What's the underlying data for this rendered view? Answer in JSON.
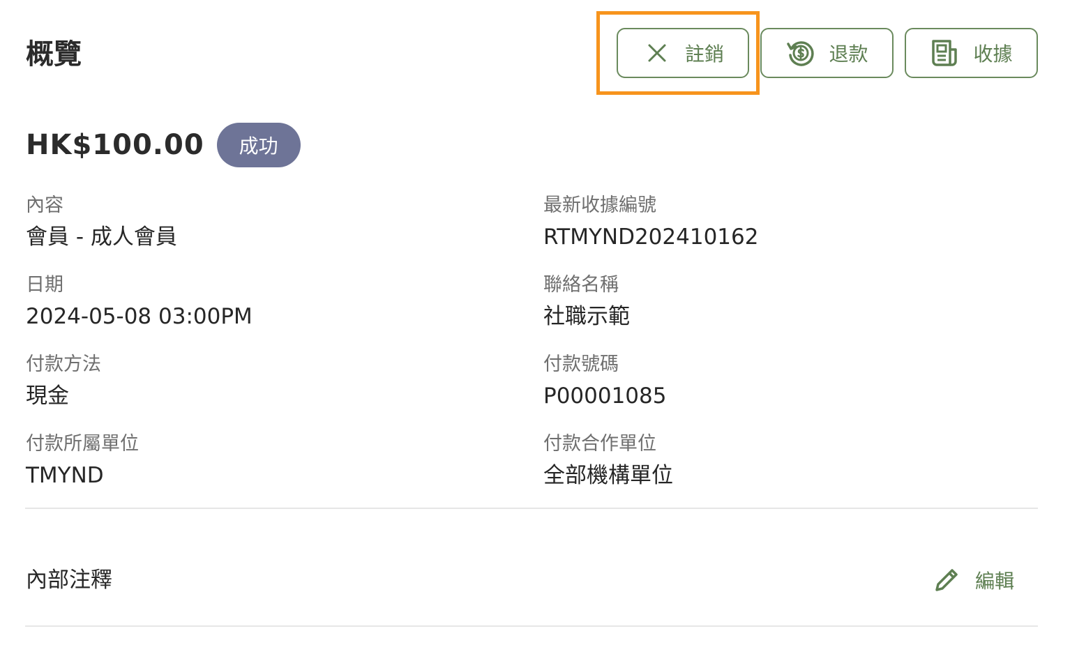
{
  "page": {
    "title": "概覽"
  },
  "actions": {
    "cancel_label": "註銷",
    "refund_label": "退款",
    "receipt_label": "收據",
    "accent_color": "#5e7f52",
    "highlight_color": "#f7941d"
  },
  "summary": {
    "amount": "HK$100.00",
    "status": "成功",
    "status_color": "#6e7497"
  },
  "details": {
    "content_label": "內容",
    "content_value": "會員 - 成人會員",
    "receipt_no_label": "最新收據編號",
    "receipt_no_value": "RTMYND202410162",
    "date_label": "日期",
    "date_value": "2024-05-08 03:00PM",
    "contact_label": "聯絡名稱",
    "contact_value": "社職示範",
    "method_label": "付款方法",
    "method_value": "現金",
    "payment_no_label": "付款號碼",
    "payment_no_value": "P00001085",
    "unit_label": "付款所屬單位",
    "unit_value": "TMYND",
    "partner_label": "付款合作單位",
    "partner_value": "全部機構單位"
  },
  "notes": {
    "title": "內部注釋",
    "edit_label": "編輯"
  },
  "icons": {
    "cancel": "close-icon",
    "refund": "refund-dollar-icon",
    "receipt": "receipt-icon",
    "edit": "pencil-icon"
  }
}
